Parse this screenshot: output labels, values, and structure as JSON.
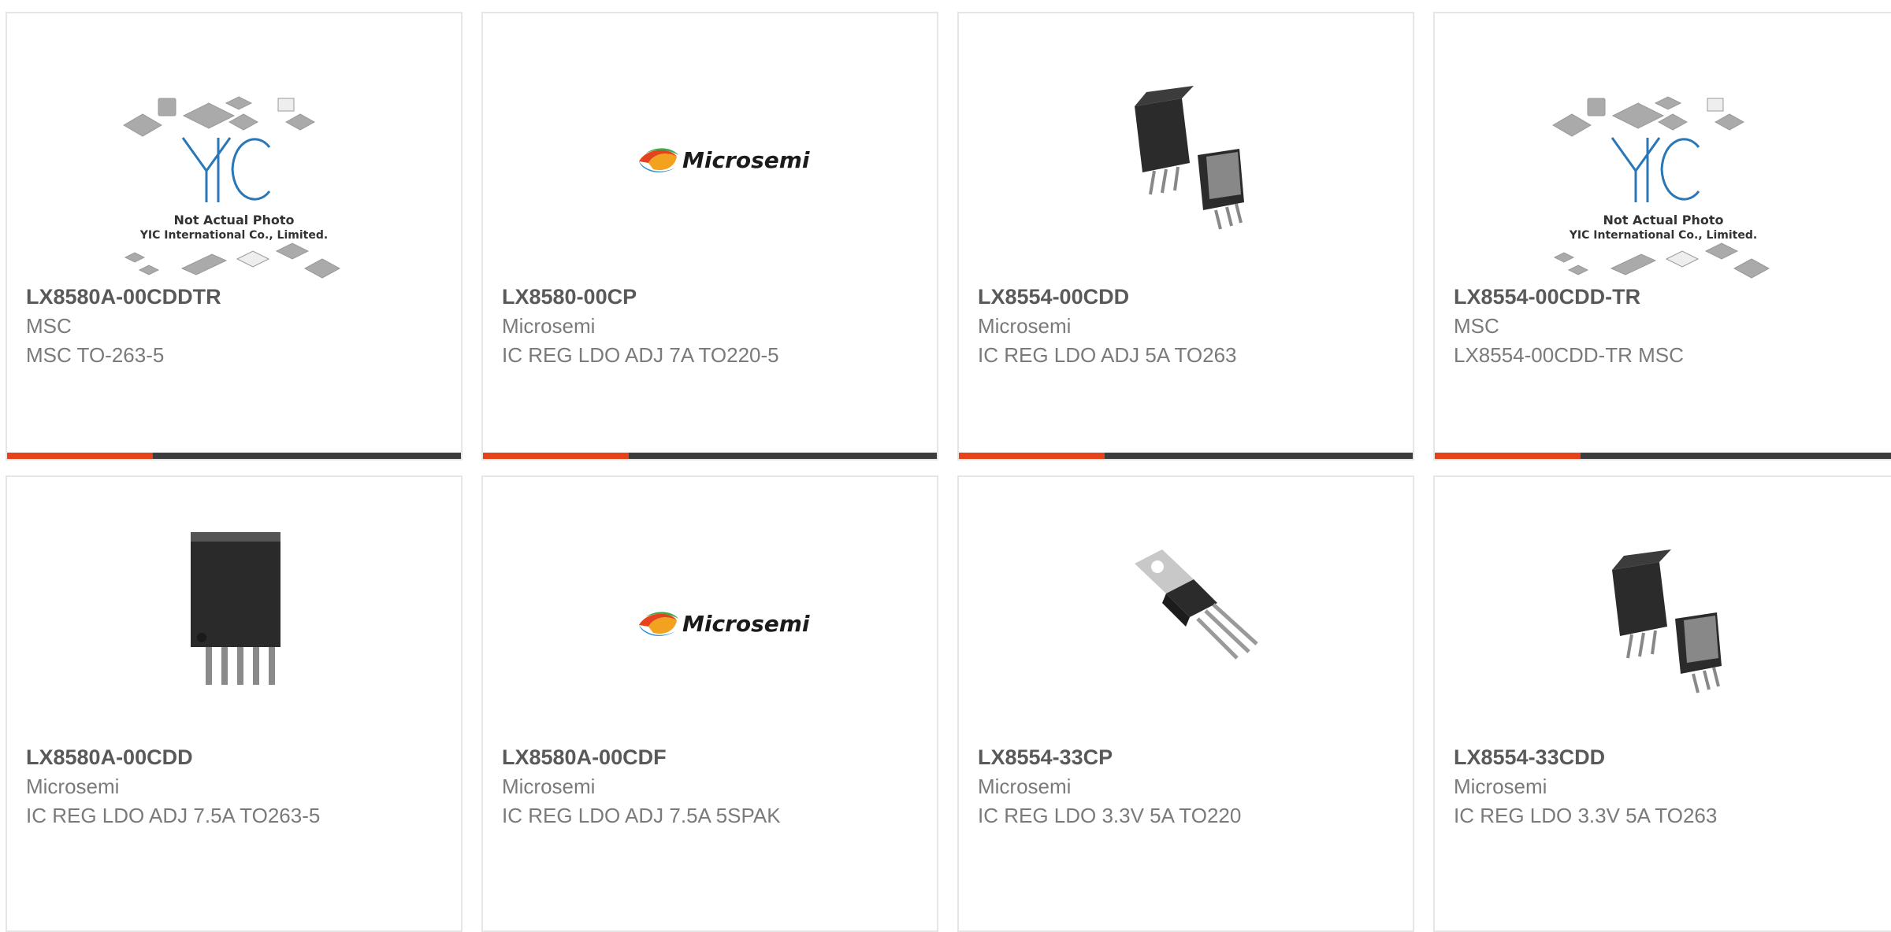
{
  "colors": {
    "accent": "#e4431b",
    "bar": "#3d3d3d",
    "border": "#e6e6e6",
    "part_number": "#595959",
    "text": "#7a7a7a"
  },
  "products": [
    {
      "part_number": "LX8580A-00CDDTR",
      "manufacturer": "MSC",
      "description": "MSC TO-263-5",
      "image": {
        "type": "placeholder",
        "brand": "YIC",
        "line1": "Not Actual Photo",
        "line2": "YIC International Co., Limited."
      }
    },
    {
      "part_number": "LX8580-00CP",
      "manufacturer": "Microsemi",
      "description": "IC REG LDO ADJ 7A TO220-5",
      "image": {
        "type": "logo",
        "text": "Microsemi"
      }
    },
    {
      "part_number": "LX8554-00CDD",
      "manufacturer": "Microsemi",
      "description": "IC REG LDO ADJ 5A TO263",
      "image": {
        "type": "d2pak-pair"
      }
    },
    {
      "part_number": "LX8554-00CDD-TR",
      "manufacturer": "MSC",
      "description": "LX8554-00CDD-TR MSC",
      "image": {
        "type": "placeholder",
        "brand": "YIC",
        "line1": "Not Actual Photo",
        "line2": "YIC International Co., Limited."
      }
    },
    {
      "part_number": "LX8580A-00CDD",
      "manufacturer": "Microsemi",
      "description": "IC REG LDO ADJ 7.5A TO263-5",
      "image": {
        "type": "to263-5"
      }
    },
    {
      "part_number": "LX8580A-00CDF",
      "manufacturer": "Microsemi",
      "description": "IC REG LDO ADJ 7.5A 5SPAK",
      "image": {
        "type": "logo",
        "text": "Microsemi"
      }
    },
    {
      "part_number": "LX8554-33CP",
      "manufacturer": "Microsemi",
      "description": "IC REG LDO 3.3V 5A TO220",
      "image": {
        "type": "to220"
      }
    },
    {
      "part_number": "LX8554-33CDD",
      "manufacturer": "Microsemi",
      "description": "IC REG LDO 3.3V 5A TO263",
      "image": {
        "type": "d2pak-pair"
      }
    }
  ]
}
